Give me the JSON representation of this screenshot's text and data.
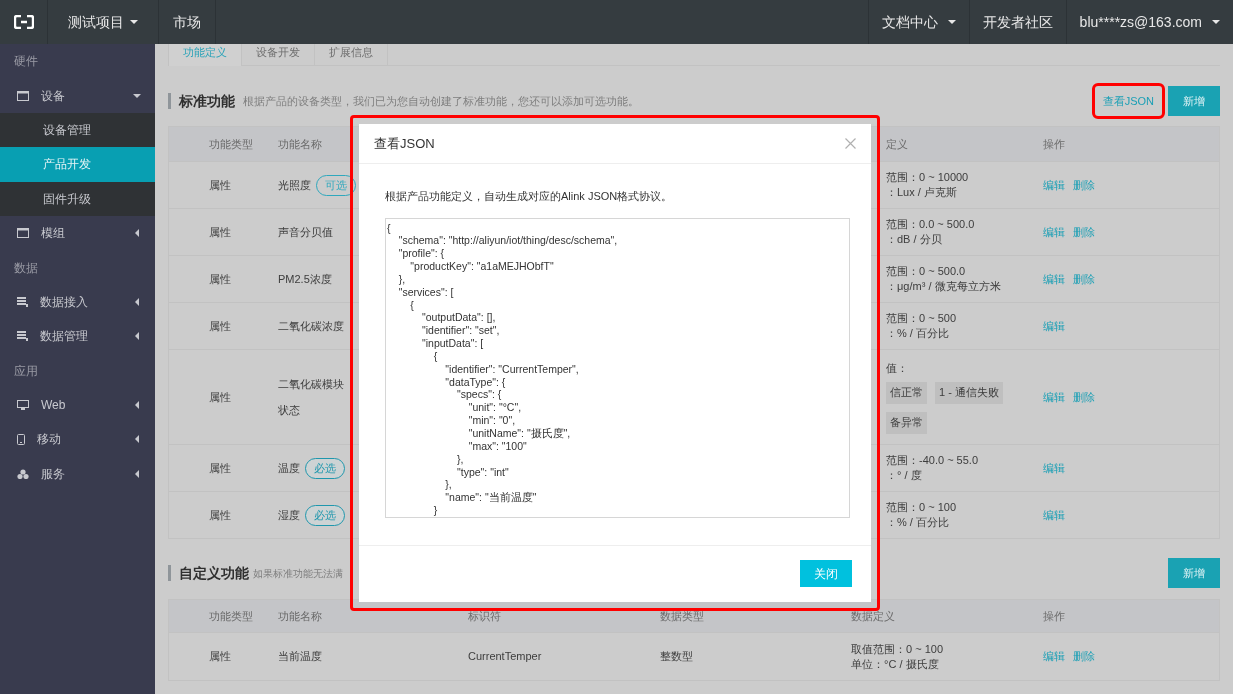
{
  "topbar": {
    "project": "测试项目",
    "market": "市场",
    "right": [
      {
        "label": "文档中心",
        "dropdown": true
      },
      {
        "label": "开发者社区",
        "dropdown": false
      },
      {
        "label": "blu****zs@163.com",
        "dropdown": true
      }
    ]
  },
  "sidebar": [
    {
      "label": "硬件",
      "items": [
        {
          "label": "设备",
          "expanded": true,
          "children": [
            {
              "label": "设备管理",
              "selected": false
            },
            {
              "label": "产品开发",
              "selected": true
            },
            {
              "label": "固件升级",
              "selected": false
            }
          ]
        },
        {
          "label": "模组",
          "expanded": false
        }
      ]
    },
    {
      "label": "数据",
      "items": [
        {
          "label": "数据接入",
          "expanded": false
        },
        {
          "label": "数据管理",
          "expanded": false
        }
      ]
    },
    {
      "label": "应用",
      "items": [
        {
          "label": "Web",
          "expanded": false
        },
        {
          "label": "移动",
          "expanded": false
        },
        {
          "label": "服务",
          "expanded": false
        }
      ]
    }
  ],
  "tabs": [
    {
      "label": "功能定义",
      "selected": true
    },
    {
      "label": "设备开发",
      "selected": false
    },
    {
      "label": "扩展信息",
      "selected": false
    }
  ],
  "standard": {
    "title": "标准功能",
    "description": "根据产品的设备类型，我们已为您自动创建了标准功能，您还可以添加可选功能。",
    "buttons": [
      {
        "label": "查看JSON",
        "kind": "link",
        "highlighted": true
      },
      {
        "label": "新增",
        "kind": "primary",
        "highlighted": false
      }
    ],
    "columns": [
      "功能类型",
      "功能名称",
      "定义",
      "操作"
    ],
    "rows": [
      {
        "type": "属性",
        "name": "光照度",
        "tag": {
          "label": "可选",
          "kind": "optional"
        },
        "definition": [
          "范围：0 ~ 10000",
          "：Lux / 卢克斯"
        ],
        "actions": [
          "编辑",
          "删除"
        ]
      },
      {
        "type": "属性",
        "name": "声音分贝值",
        "definition": [
          "范围：0.0 ~ 500.0",
          "：dB / 分贝"
        ],
        "actions": [
          "编辑",
          "删除"
        ]
      },
      {
        "type": "属性",
        "name": "PM2.5浓度",
        "definition": [
          "范围：0 ~ 500.0",
          "：μg/m³ / 微克每立方米"
        ],
        "actions": [
          "编辑",
          "删除"
        ]
      },
      {
        "type": "属性",
        "name": "二氧化碳浓度",
        "definition": [
          "范围：0 ~ 500",
          "：% / 百分比"
        ],
        "actions": [
          "编辑"
        ]
      },
      {
        "type": "属性",
        "name": "二氧化碳模块状态",
        "definition": [
          "值："
        ],
        "enums": [
          "信正常",
          "1 - 通信失败",
          "备异常"
        ],
        "actions": [
          "编辑",
          "删除"
        ]
      },
      {
        "type": "属性",
        "name": "温度",
        "tag": {
          "label": "必选",
          "kind": "required"
        },
        "definition": [
          "范围：-40.0 ~ 55.0",
          "：° / 度"
        ],
        "actions": [
          "编辑"
        ]
      },
      {
        "type": "属性",
        "name": "湿度",
        "tag": {
          "label": "必选",
          "kind": "required"
        },
        "definition": [
          "范围：0 ~ 100",
          "：% / 百分比"
        ],
        "actions": [
          "编辑"
        ]
      }
    ]
  },
  "custom": {
    "title": "自定义功能",
    "description": "如果标准功能无法满",
    "button": "新增",
    "columns": [
      "功能类型",
      "功能名称",
      "标识符",
      "数据类型",
      "数据定义",
      "操作"
    ],
    "rows": [
      {
        "type": "属性",
        "name": "当前温度",
        "identifier": "CurrentTemper",
        "data_type": "整数型",
        "definition": [
          "取值范围：0 ~ 100",
          "单位：°C / 摄氏度"
        ],
        "actions": [
          "编辑",
          "删除"
        ]
      }
    ]
  },
  "modal": {
    "title": "查看JSON",
    "description": "根据产品功能定义，自动生成对应的Alink JSON格式协议。",
    "code": "{\n    \"schema\": \"http://aliyun/iot/thing/desc/schema\",\n    \"profile\": {\n        \"productKey\": \"a1aMEJHObfT\"\n    },\n    \"services\": [\n        {\n            \"outputData\": [],\n            \"identifier\": \"set\",\n            \"inputData\": [\n                {\n                    \"identifier\": \"CurrentTemper\",\n                    \"dataType\": {\n                        \"specs\": {\n                            \"unit\": \"°C\",\n                            \"min\": \"0\",\n                            \"unitName\": \"摄氏度\",\n                            \"max\": \"100\"\n                        },\n                        \"type\": \"int\"\n                    },\n                    \"name\": \"当前温度\"\n                }",
    "button": "关闭",
    "highlighted": true
  }
}
